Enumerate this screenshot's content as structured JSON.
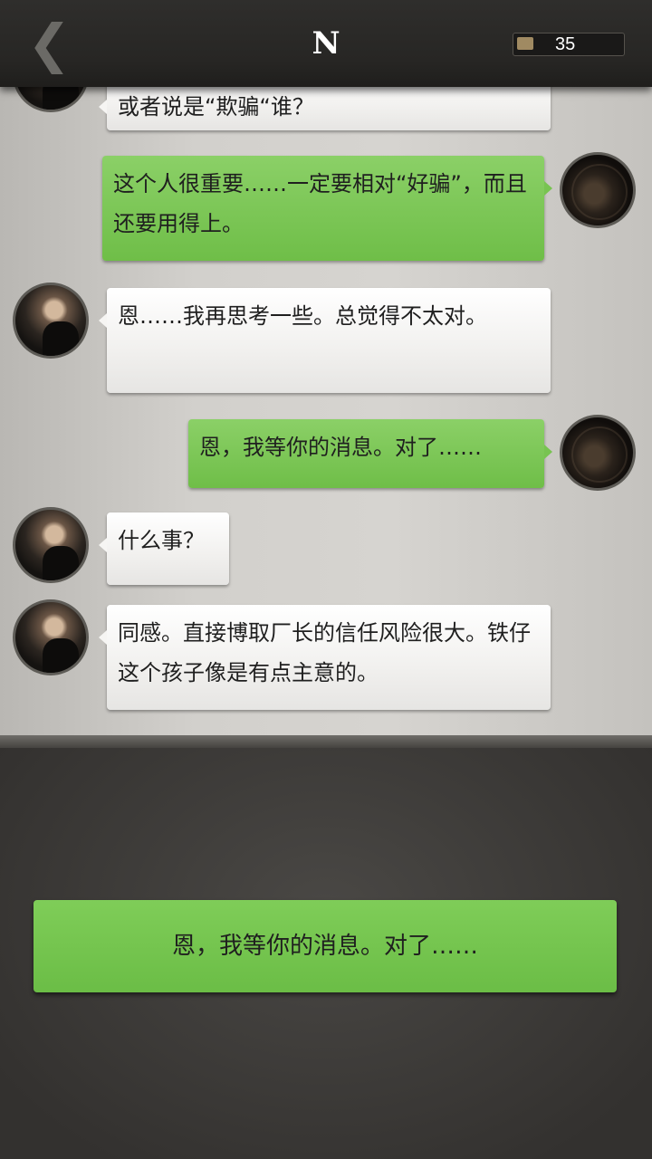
{
  "header": {
    "title": "N",
    "back_glyph": "❮",
    "coins": "35",
    "coin_icon": "coin-icon"
  },
  "messages": [
    {
      "side": "left",
      "text": "或者说是“欺骗“谁？"
    },
    {
      "side": "right",
      "text": "这个人很重要……一定要相对“好骗”，而且还要用得上。"
    },
    {
      "side": "left",
      "text": "恩……我再思考一些。总觉得不太对。"
    },
    {
      "side": "right",
      "text": "恩，我等你的消息。对了……"
    },
    {
      "side": "left",
      "text": "什么事？"
    },
    {
      "side": "left",
      "text": "同感。直接博取厂长的信任风险很大。铁仔这个孩子像是有点主意的。"
    }
  ],
  "reply": {
    "text": "恩，我等你的消息。对了……"
  },
  "colors": {
    "incoming_bubble": "#f1f0ee",
    "outgoing_bubble": "#78c351",
    "reply_button": "#74c54e",
    "header": "#272624"
  }
}
